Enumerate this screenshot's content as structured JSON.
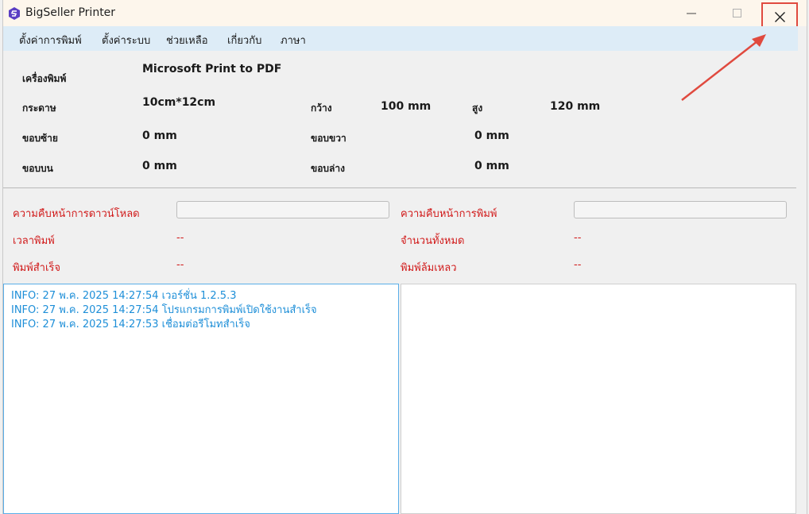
{
  "window": {
    "title": "BigSeller Printer",
    "close_icon": "close-icon",
    "minimize_icon": "minimize-icon",
    "maximize_icon": "maximize-icon"
  },
  "menu": {
    "items": [
      "ตั้งค่าการพิมพ์",
      "ตั้งค่าระบบ",
      "ช่วยเหลือ",
      "เกี่ยวกับ",
      "ภาษา"
    ]
  },
  "printer": {
    "printer_label": "เครื่องพิมพ์",
    "printer_value": "Microsoft Print to PDF",
    "paper_label": "กระดาษ",
    "paper_value": "10cm*12cm",
    "width_label": "กว้าง",
    "width_value": "100 mm",
    "height_label": "สูง",
    "height_value": "120 mm",
    "left_margin_label": "ขอบซ้าย",
    "left_margin_value": "0 mm",
    "right_margin_label": "ขอบขวา",
    "right_margin_value": "0 mm",
    "top_margin_label": "ขอบบน",
    "top_margin_value": "0 mm",
    "bottom_margin_label": "ขอบล่าง",
    "bottom_margin_value": "0 mm"
  },
  "status": {
    "download_progress_label": "ความคืบหน้าการดาวน์โหลด",
    "download_progress": 0,
    "print_progress_label": "ความคืบหน้าการพิมพ์",
    "print_progress": 0,
    "print_time_label": "เวลาพิมพ์",
    "print_time_value": "--",
    "total_label": "จำนวนทั้งหมด",
    "total_value": "--",
    "success_label": "พิมพ์สำเร็จ",
    "success_value": "--",
    "failed_label": "พิมพ์ล้มเหลว",
    "failed_value": "--"
  },
  "log": {
    "lines": [
      "INFO: 27 พ.ค. 2025 14:27:54 เวอร์ชั่น 1.2.5.3",
      "INFO: 27 พ.ค. 2025 14:27:54 โปรแกรมการพิมพ์เปิดใช้งานสำเร็จ",
      "INFO: 27 พ.ค. 2025 14:27:53 เชื่อมต่อรีโมทสำเร็จ"
    ]
  },
  "colors": {
    "accent_red": "#e04a3f",
    "status_red": "#d11a1a",
    "log_blue": "#1e8fd8",
    "menubar_bg": "#ddecf7"
  }
}
